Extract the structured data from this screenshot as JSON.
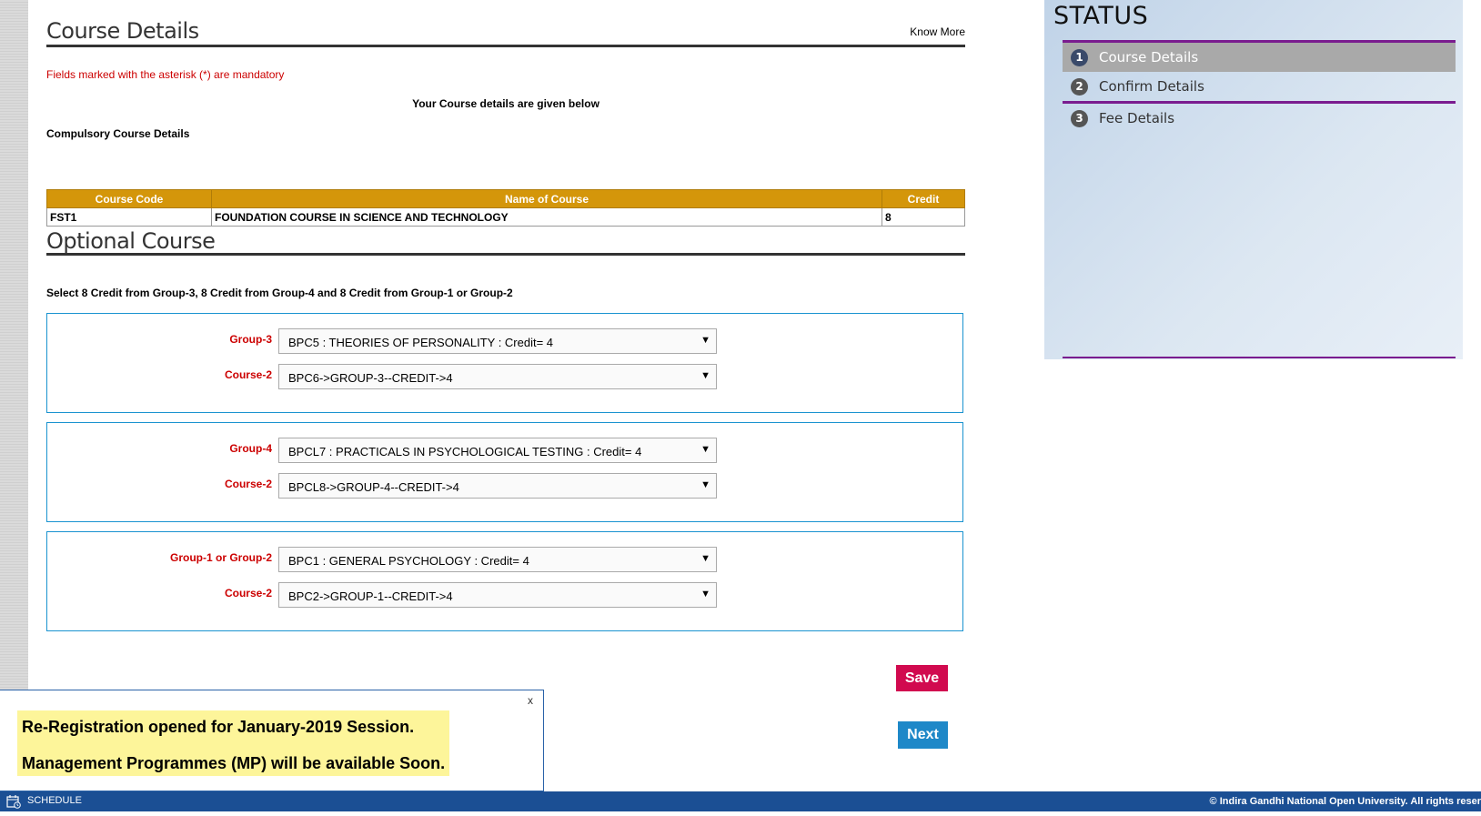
{
  "course_details": {
    "title": "Course Details",
    "know_more": "Know More",
    "mandatory_note": "Fields marked with the asterisk (*) are mandatory",
    "given_below": "Your Course details are given below",
    "compulsory_label": "Compulsory Course Details",
    "table": {
      "headers": [
        "Course Code",
        "Name of Course",
        "Credit"
      ],
      "rows": [
        [
          "FST1",
          "FOUNDATION COURSE IN SCIENCE AND TECHNOLOGY",
          "8"
        ]
      ]
    }
  },
  "optional_course": {
    "title": "Optional Course",
    "instruction": "Select 8 Credit from Group-3, 8 Credit from Group-4 and 8 Credit from Group-1 or Group-2",
    "groups": [
      {
        "label1": "Group-3",
        "value1": "BPC5 : THEORIES OF PERSONALITY : Credit= 4",
        "label2": "Course-2",
        "value2": "BPC6->GROUP-3--CREDIT->4"
      },
      {
        "label1": "Group-4",
        "value1": "BPCL7 : PRACTICALS IN PSYCHOLOGICAL TESTING : Credit= 4",
        "label2": "Course-2",
        "value2": "BPCL8->GROUP-4--CREDIT->4"
      },
      {
        "label1": "Group-1 or Group-2",
        "value1": "BPC1 : GENERAL PSYCHOLOGY : Credit= 4",
        "label2": "Course-2",
        "value2": "BPC2->GROUP-1--CREDIT->4"
      }
    ]
  },
  "buttons": {
    "save": "Save",
    "next": "Next"
  },
  "status": {
    "title": "STATUS",
    "steps": [
      {
        "num": "1",
        "label": "Course Details"
      },
      {
        "num": "2",
        "label": "Confirm Details"
      },
      {
        "num": "3",
        "label": "Fee Details"
      }
    ]
  },
  "notice": {
    "close": "x",
    "line1": "Re-Registration opened for January-2019 Session.",
    "line2": "Management Programmes (MP) will be available Soon."
  },
  "footer": {
    "schedule": "SCHEDULE",
    "copyright": "© Indira Gandhi National Open University. All rights reser"
  },
  "colors": {
    "accent_gold": "#d4960a",
    "accent_purple": "#7a1c8f",
    "save": "#d10a4f",
    "next": "#1e88c8",
    "footer": "#1b4f94"
  }
}
